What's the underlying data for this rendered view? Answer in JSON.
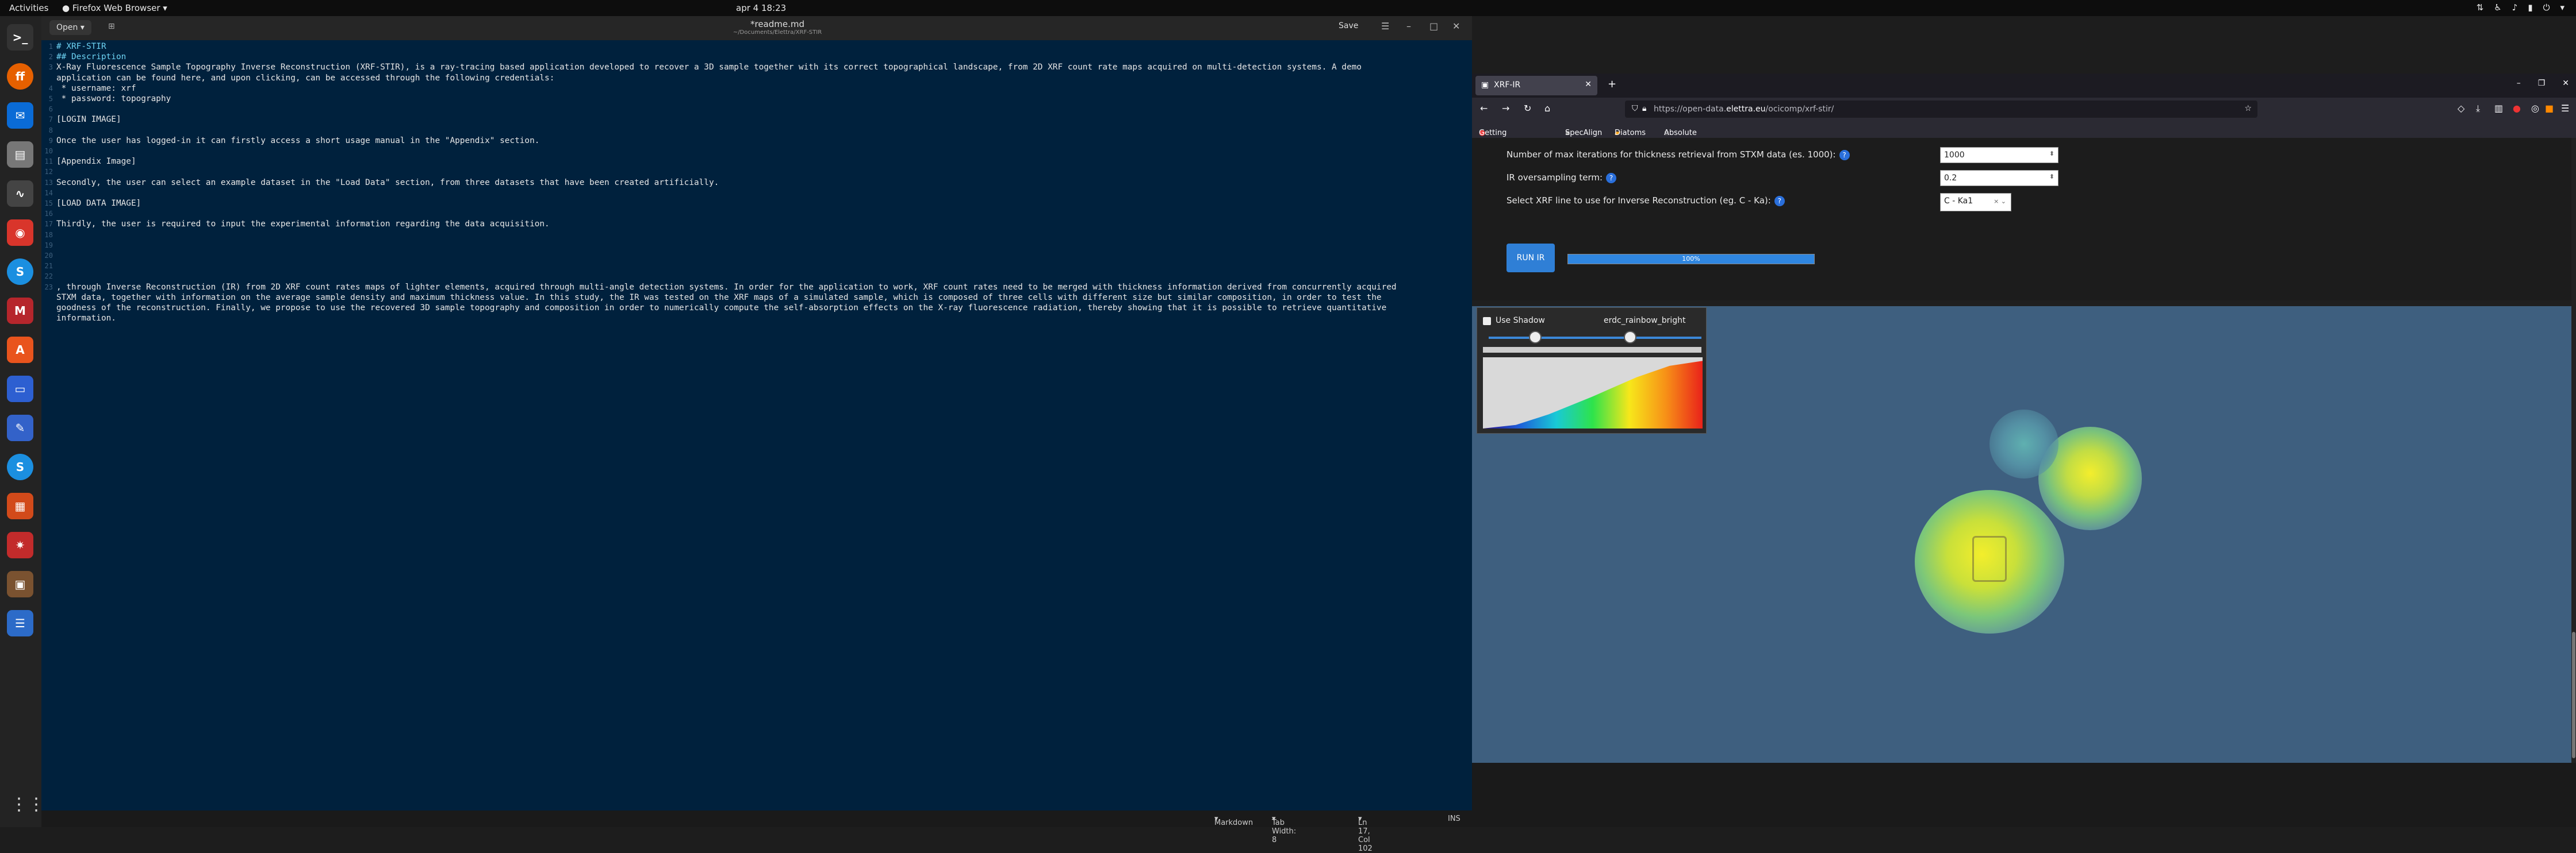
{
  "topbar": {
    "activities": "Activities",
    "app": "Firefox Web Browser",
    "clock": "apr 4  18:23"
  },
  "dock": [
    "terminal",
    "firefox",
    "thunderbird",
    "files",
    "monitor",
    "screenshot",
    "skype",
    "mendeley",
    "store",
    "screen",
    "editor",
    "skype2",
    "document",
    "settings",
    "photos",
    "reader"
  ],
  "editor": {
    "open_label": "Open",
    "title": "*readme.md",
    "subtitle": "~/Documents/Elettra/XRF-STIR",
    "save_label": "Save",
    "lines": [
      "# XRF-STIR",
      "## Description",
      "X-Ray Fluorescence Sample Topography Inverse Reconstruction (XRF-STIR), is a ray-tracing based application developed to recover a 3D sample together with its correct topographical landscape, from 2D XRF count rate maps acquired on multi-detection systems. A demo",
      "application can be found here, and upon clicking, can be accessed through the following credentials:",
      " * username: xrf",
      " * password: topography",
      "",
      "[LOGIN IMAGE]",
      "",
      "Once the user has logged-in it can firstly access a short usage manual in the \"Appendix\" section.",
      "",
      "[Appendix Image]",
      "",
      "Secondly, the user can select an example dataset in the \"Load Data\" section, from three datasets that have been created artificially.",
      "",
      "[LOAD DATA IMAGE]",
      "",
      "Thirdly, the user is required to input the experimental information regarding the data acquisition.",
      "",
      "",
      "",
      "",
      "",
      ", through Inverse Reconstruction (IR) from 2D XRF count rates maps of lighter elements, acquired through multi-angle detection systems. In order for the application to work, XRF count rates need to be merged with thickness information derived from concurrently acquired",
      "STXM data, together with information on the average sample density and maximum thickness value. In this study, the IR was tested on the XRF maps of a simulated sample, which is composed of three cells with different size but similar composition, in order to test the",
      "goodness of the reconstruction. Finally, we propose to use the recovered 3D sample topography and composition in order to numerically compute the self-absorption effects on the X-ray fluorescence radiation, thereby showing that it is possible to retrieve quantitative",
      "information."
    ],
    "gutter": [
      "1",
      "2",
      "3",
      "",
      "4",
      "5",
      "6",
      "7",
      "8",
      "9",
      "10",
      "11",
      "12",
      "13",
      "14",
      "15",
      "16",
      "17",
      "18",
      "19",
      "20",
      "21",
      "22",
      "23",
      "",
      "",
      ""
    ],
    "status": {
      "lang": "Markdown",
      "tab": "Tab Width: 8",
      "pos": "Ln 17, Col 102",
      "mode": "INS"
    }
  },
  "firefox": {
    "tab_title": "XRF-IR",
    "url_prefix": "https://open-data.",
    "url_domain": "elettra.eu",
    "url_suffix": "/ocicomp/xrf-stir/",
    "bookmarks": [
      "Getting Started",
      "SpecAlign",
      "Diatoms",
      "Absolute paths for da..."
    ]
  },
  "form": {
    "iter_label": "Number of max iterations for thickness retrieval from STXM data (es. 1000):",
    "iter_value": "1000",
    "oversampling_label": "IR oversampling term:",
    "oversampling_value": "0.2",
    "xrf_label": "Select XRF line to use for Inverse Reconstruction (eg. C - Ka):",
    "xrf_value": "C - Ka1",
    "run_label": "RUN IR",
    "progress_label": "100%",
    "progress_fraction": 1.0
  },
  "viewer": {
    "shadow_label": "Use Shadow",
    "colormap": "erdc_rainbow_bright"
  },
  "colors": {
    "editor_bg": "#00213d",
    "accent": "#2f7fd6",
    "viewer_bg": "#3e5f7f"
  }
}
